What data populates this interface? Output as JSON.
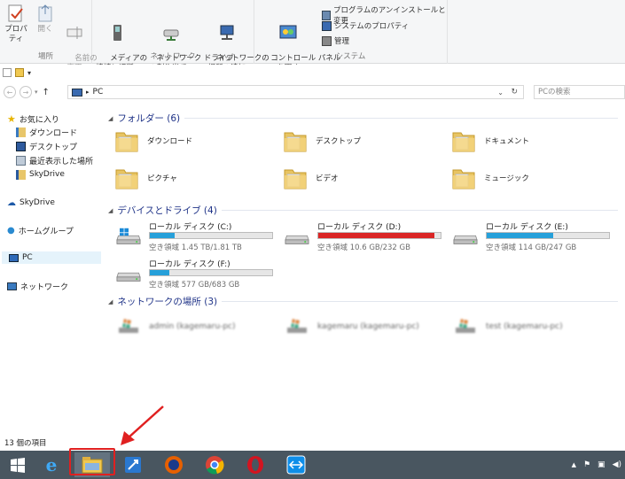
{
  "ribbon": {
    "groups": [
      {
        "label": "場所",
        "buttons": [
          "プロパティ",
          "開く",
          "名前の\n変更"
        ]
      },
      {
        "label": "ネットワーク",
        "buttons": [
          "メディアの\n接続と切断 ▾",
          "ネットワーク ドライブ\nの割り当て ▾",
          "ネットワークの\n場所の追加"
        ]
      },
      {
        "label": "システム",
        "buttons": [
          "コントロール パネル\nを開く"
        ],
        "small": [
          "プログラムのアンインストールと変更",
          "システムのプロパティ",
          "管理"
        ]
      }
    ]
  },
  "address": {
    "path": "PC",
    "search_placeholder": "PCの検索"
  },
  "nav": {
    "favorites": "お気に入り",
    "downloads": "ダウンロード",
    "desktop": "デスクトップ",
    "recent": "最近表示した場所",
    "skydrive_fav": "SkyDrive",
    "skydrive": "SkyDrive",
    "homegroup": "ホームグループ",
    "pc": "PC",
    "network": "ネットワーク"
  },
  "groups": {
    "folders": "フォルダー (6)",
    "devices": "デバイスとドライブ (4)",
    "network": "ネットワークの場所 (3)"
  },
  "folders": [
    {
      "name": "ダウンロード",
      "icon": "download-folder-icon"
    },
    {
      "name": "デスクトップ",
      "icon": "desktop-folder-icon"
    },
    {
      "name": "ドキュメント",
      "icon": "documents-folder-icon"
    },
    {
      "name": "ピクチャ",
      "icon": "pictures-folder-icon"
    },
    {
      "name": "ビデオ",
      "icon": "videos-folder-icon"
    },
    {
      "name": "ミュージック",
      "icon": "music-folder-icon"
    }
  ],
  "drives": [
    {
      "name": "ローカル ディスク (C:)",
      "free": "空き領域 1.45 TB/1.81 TB",
      "used_fraction": 0.2,
      "color": "#26a0da"
    },
    {
      "name": "ローカル ディスク (D:)",
      "free": "空き領域 10.6 GB/232 GB",
      "used_fraction": 0.95,
      "color": "#da2626"
    },
    {
      "name": "ローカル ディスク (E:)",
      "free": "空き領域 114 GB/247 GB",
      "used_fraction": 0.54,
      "color": "#26a0da"
    },
    {
      "name": "ローカル ディスク (F:)",
      "free": "空き領域 577 GB/683 GB",
      "used_fraction": 0.16,
      "color": "#26a0da"
    }
  ],
  "network_places": [
    {
      "name": "admin (kagemaru-pc)"
    },
    {
      "name": "kagemaru (kagemaru-pc)"
    },
    {
      "name": "test (kagemaru-pc)"
    }
  ],
  "status": {
    "count": "13 個の項目"
  },
  "taskbar": {
    "apps": [
      "start-icon",
      "ie-icon",
      "explorer-icon",
      "rocket-icon",
      "firefox-icon",
      "chrome-icon",
      "opera-icon",
      "teamviewer-icon"
    ]
  }
}
